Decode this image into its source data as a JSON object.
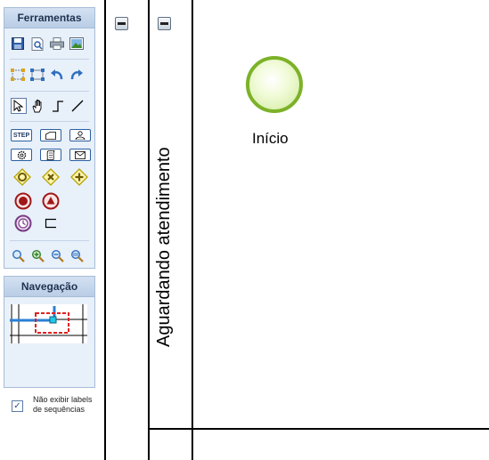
{
  "toolbox": {
    "title": "Ferramentas",
    "groups": [
      [
        "save-icon",
        "print-preview-icon",
        "print-icon",
        "export-image-icon"
      ],
      [
        "select-group-icon",
        "ungroup-icon",
        "undo-icon",
        "redo-icon"
      ],
      [
        "pointer-icon",
        "hand-pan-icon",
        "elbow-connector-icon",
        "straight-connector-icon"
      ],
      [
        "step-task-icon",
        "manual-task-icon",
        "user-task-icon",
        "service-task-icon",
        "script-task-icon",
        "message-task-icon",
        "gateway-exclusive-icon",
        "gateway-x-icon",
        "gateway-parallel-icon",
        "end-event-icon",
        "error-event-icon",
        "timer-event-icon",
        "annotation-icon"
      ],
      [
        "zoom-fit-icon",
        "zoom-in-icon",
        "zoom-out-icon",
        "zoom-actual-icon"
      ]
    ],
    "step_label": "STEP"
  },
  "navigation": {
    "title": "Navegação"
  },
  "options": {
    "hide_labels_checked": true,
    "hide_labels_text": "Não exibir labels de sequências"
  },
  "diagram": {
    "lane_name": "Aguardando atendimento",
    "start_event_label": "Início"
  },
  "colors": {
    "panel_bg": "#e8f0fa",
    "panel_border": "#a7bdd7",
    "start_event_stroke": "#7cb228",
    "accent_blue": "#2a7fd4",
    "viewport_red": "#e02020"
  }
}
